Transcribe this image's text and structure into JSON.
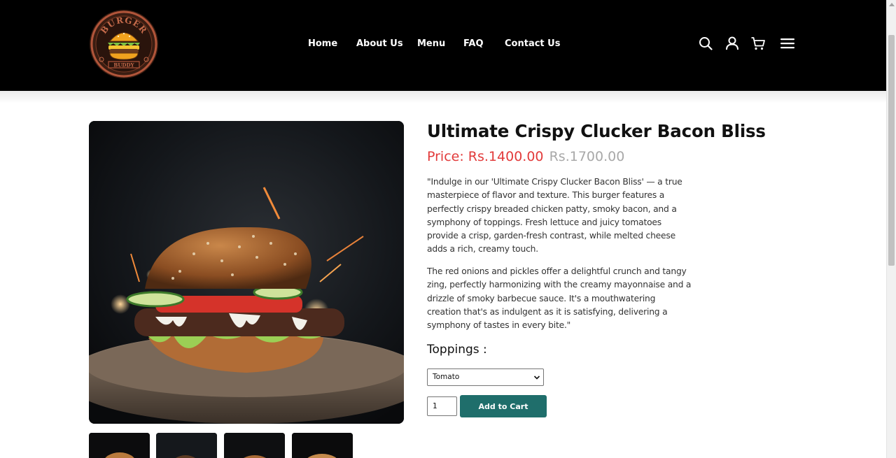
{
  "brand": {
    "logo_text_top": "BURGER",
    "logo_text_bottom": "BUDDY"
  },
  "nav": {
    "items": [
      {
        "label": "Home"
      },
      {
        "label": "About Us"
      },
      {
        "label": "Menu"
      },
      {
        "label": "FAQ"
      },
      {
        "label": "Contact Us"
      }
    ]
  },
  "header_icons": [
    "search-icon",
    "user-icon",
    "cart-icon",
    "menu-icon"
  ],
  "product": {
    "title": "Ultimate Crispy Clucker Bacon Bliss",
    "price_label": "Price: Rs.1400.00",
    "old_price": "Rs.1700.00",
    "description_1": "\"Indulge in our 'Ultimate Crispy Clucker Bacon Bliss' — a true masterpiece of flavor and texture. This burger features a perfectly crispy breaded chicken patty, smoky bacon, and a symphony of toppings. Fresh lettuce and juicy tomatoes provide a crisp, garden-fresh contrast, while melted cheese adds a rich, creamy touch.",
    "description_2": "The red onions and pickles offer a delightful crunch and tangy zing, perfectly harmonizing with the creamy mayonnaise and a drizzle of smoky barbecue sauce. It's a mouthwatering creation that's as indulgent as it is satisfying, delivering a symphony of tastes in every bite.\"",
    "toppings_label": "Toppings :",
    "toppings_selected": "Tomato",
    "quantity": "1",
    "add_to_cart": "Add to Cart"
  },
  "colors": {
    "header_bg": "#000000",
    "price": "#e23b3b",
    "old_price": "#a8a8a8",
    "button": "#1f6e6b"
  }
}
